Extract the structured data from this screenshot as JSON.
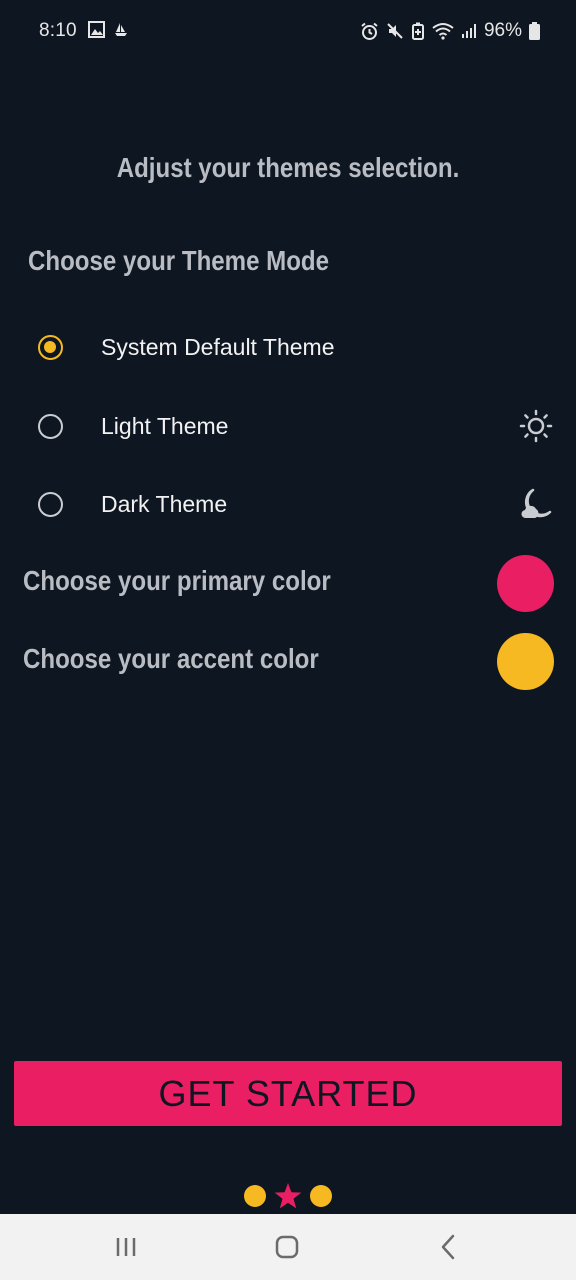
{
  "status_bar": {
    "time": "8:10",
    "battery_percent": "96%",
    "left_icons": [
      "image-icon",
      "boat-icon"
    ],
    "right_icons": [
      "alarm-icon",
      "mute-icon",
      "battery-saver-icon",
      "wifi-icon",
      "signal-icon",
      "battery-icon"
    ]
  },
  "page": {
    "headline": "Adjust your themes selection.",
    "theme_mode_title": "Choose your Theme Mode",
    "theme_options": [
      {
        "label": "System Default Theme",
        "selected": true,
        "icon": null
      },
      {
        "label": "Light Theme",
        "selected": false,
        "icon": "sun-icon"
      },
      {
        "label": "Dark Theme",
        "selected": false,
        "icon": "moon-icon"
      }
    ],
    "primary_color_label": "Choose your primary color",
    "primary_color": "#e91e63",
    "accent_color_label": "Choose your accent color",
    "accent_color": "#f6b921"
  },
  "cta": {
    "label": "GET STARTED"
  },
  "pager": {
    "items": [
      "dot",
      "star",
      "dot"
    ],
    "active_index": 1,
    "active_color": "#e91e63",
    "inactive_color": "#f6b921"
  },
  "nav_bar": {
    "buttons": [
      "recent-apps-icon",
      "home-icon",
      "back-icon"
    ]
  }
}
